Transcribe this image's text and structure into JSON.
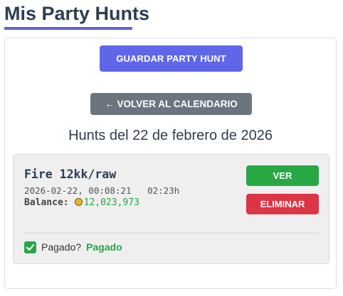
{
  "page": {
    "title": "Mis Party Hunts"
  },
  "actions": {
    "save_label": "GUARDAR PARTY HUNT",
    "back_label": "← VOLVER AL CALENDARIO"
  },
  "hunts_heading": "Hunts del 22 de febrero de 2026",
  "hunts": [
    {
      "name": "Fire 12kk/raw",
      "datetime": "2026-02-22, 00:08:21",
      "duration": "02:23h",
      "balance_label": "Balance:",
      "balance_value": "12,023,973",
      "view_label": "VER",
      "delete_label": "ELIMINAR",
      "paid_question": "Pagado?",
      "paid_checked": true,
      "paid_status": "Pagado"
    }
  ],
  "icons": {
    "coin": "gold-coin-icon",
    "checkbox": "check-icon"
  },
  "colors": {
    "primary": "#5f67e8",
    "secondary": "#6c757d",
    "success": "#28a745",
    "danger": "#dc3545",
    "heading": "#2c3e50"
  }
}
